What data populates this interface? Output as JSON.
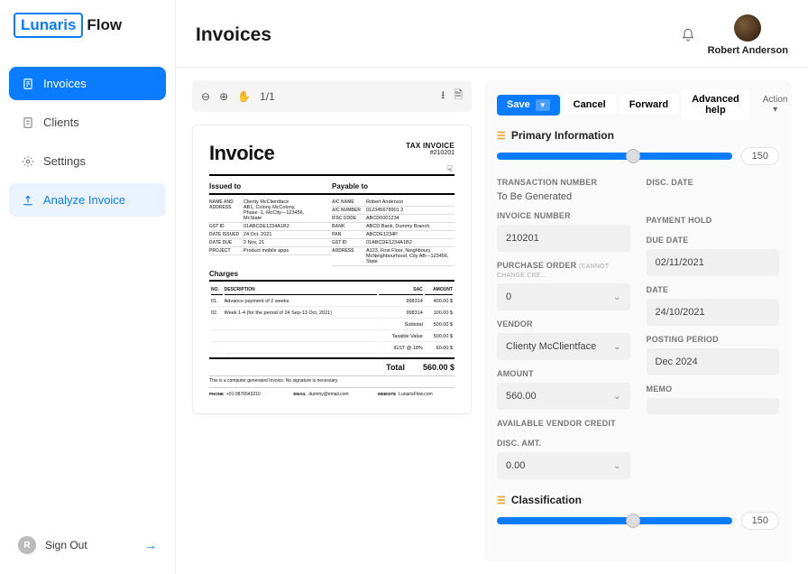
{
  "brand": {
    "boxed": "Lunaris",
    "rest": "Flow"
  },
  "nav": {
    "invoices": "Invoices",
    "clients": "Clients",
    "settings": "Settings",
    "analyze": "Analyze Invoice"
  },
  "signout": {
    "initial": "R",
    "label": "Sign Out"
  },
  "header": {
    "title": "Invoices",
    "user": "Robert Anderson"
  },
  "preview_toolbar": {
    "pages": "1/1"
  },
  "doc": {
    "title": "Invoice",
    "tax_label": "TAX INVOICE",
    "number": "#210201",
    "issued_to_h": "Issued to",
    "payable_to_h": "Payable to",
    "issued": {
      "name_lbl": "Name and Address",
      "name_val": "Clienty McClientface",
      "addr1": "AB1, Colony McColony,",
      "addr2": "Phase -1, McCity—123456,",
      "addr3": "McState",
      "gst_lbl": "GST ID",
      "gst_val": "01ABCDE1234A1B2",
      "date_issued_lbl": "Date Issued",
      "date_issued_val": "24 Oct, 2021",
      "date_due_lbl": "Date Due",
      "date_due_val": "2 Nov, 21",
      "project_lbl": "Project",
      "project_val": "Product mobile apps"
    },
    "payable": {
      "ac_name_lbl": "A/C Name",
      "ac_name_val": "Robert Anderson",
      "ac_num_lbl": "A/C Number",
      "ac_num_val": "012345678901 2",
      "ifsc_lbl": "IFSC Code",
      "ifsc_val": "ABCD0001234",
      "bank_lbl": "Bank",
      "bank_val": "ABCD Bank, Dummy Branch",
      "pan_lbl": "PAN",
      "pan_val": "ABCDE1234P",
      "gst_lbl": "GST ID",
      "gst_val": "01ABCDE1234A1B2",
      "addr_lbl": "Address",
      "addr_val": "A123, First Floor, Neighboury McNeighbourhood, City AB—123456, State"
    },
    "charges_h": "Charges",
    "cols": {
      "no": "No.",
      "desc": "Description",
      "sac": "SAC",
      "amt": "Amount"
    },
    "rows": [
      {
        "no": "01.",
        "desc": "Advance payment of 2 weeks",
        "sac": "998314",
        "amt": "400.00 $"
      },
      {
        "no": "02.",
        "desc": "Week 1-4 (for the period of 24 Sep-13 Oct, 2021)",
        "sac": "998314",
        "amt": "100.00 $"
      }
    ],
    "subtotal_lbl": "Subtotal",
    "subtotal_val": "500.00 $",
    "taxable_lbl": "Taxable Value",
    "taxable_val": "500.00 $",
    "igst_lbl": "IGST @ 18%",
    "igst_val": "60.00 $",
    "total_lbl": "Total",
    "total_val": "560.00 $",
    "note": "This is a computer generated Invoice. No signature is necessary.",
    "phone_lbl": "Phone",
    "phone_val": "+91 9876543210",
    "email_lbl": "Email",
    "email_val": "dummy@email.com",
    "website_lbl": "Website",
    "website_val": "LunarisFlow.com"
  },
  "form": {
    "save": "Save",
    "cancel": "Cancel",
    "forward": "Forward",
    "adv_help": "Advanced help",
    "action": "Action",
    "section_primary": "Primary Information",
    "slider1_val": "150",
    "txn_num_lbl": "Transaction Number",
    "txn_num_val": "To Be Generated",
    "inv_num_lbl": "Invoice Number",
    "inv_num_val": "210201",
    "po_lbl": "Purchase Order",
    "po_sub": "(cannot change cre...",
    "po_val": "0",
    "vendor_lbl": "Vendor",
    "vendor_val": "Clienty McClientface",
    "amount_lbl": "Amount",
    "amount_val": "560.00",
    "avc_lbl": "Available Vendor Credit",
    "disc_amt_lbl": "Disc. Amt.",
    "disc_amt_val": "0.00",
    "disc_date_lbl": "Disc. Date",
    "pay_hold_lbl": "Payment Hold",
    "due_date_lbl": "Due Date",
    "due_date_val": "02/11/2021",
    "date_lbl": "Date",
    "date_val": "24/10/2021",
    "posting_lbl": "Posting Period",
    "posting_val": "Dec 2024",
    "memo_lbl": "Memo",
    "section_classification": "Classification",
    "slider2_val": "150"
  }
}
